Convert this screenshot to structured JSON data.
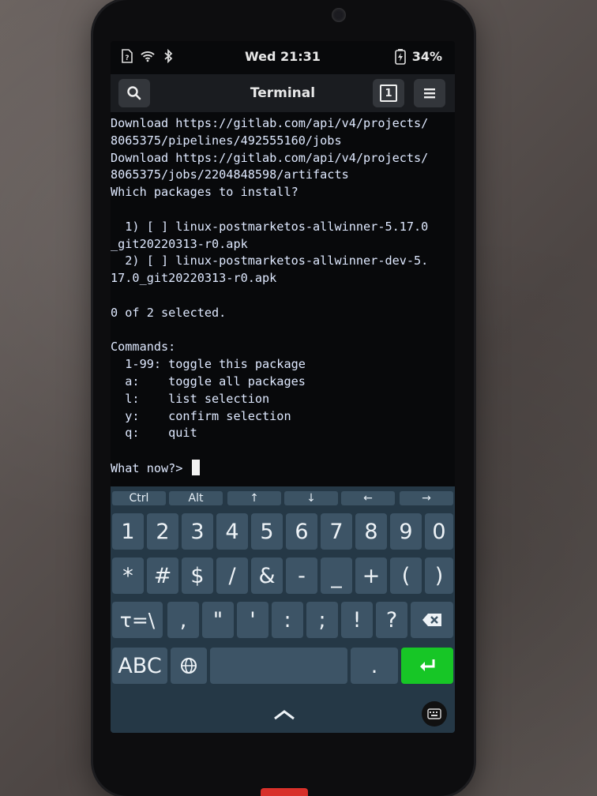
{
  "status": {
    "clock": "Wed 21:31",
    "battery": "34%",
    "icons": [
      "sim-icon",
      "wifi-icon",
      "bluetooth-icon",
      "battery-icon"
    ]
  },
  "header": {
    "title": "Terminal",
    "search_icon": "search-icon",
    "tab_count": "1",
    "menu_icon": "hamburger-menu-icon"
  },
  "terminal": {
    "lines": [
      "Download https://gitlab.com/api/v4/projects/",
      "8065375/pipelines/492555160/jobs",
      "Download https://gitlab.com/api/v4/projects/",
      "8065375/jobs/2204848598/artifacts",
      "Which packages to install?",
      "",
      "  1) [ ] linux-postmarketos-allwinner-5.17.0",
      "_git20220313-r0.apk",
      "  2) [ ] linux-postmarketos-allwinner-dev-5.",
      "17.0_git20220313-r0.apk",
      "",
      "0 of 2 selected.",
      "",
      "Commands:",
      "  1-99: toggle this package",
      "  a:    toggle all packages",
      "  l:    list selection",
      "  y:    confirm selection",
      "  q:    quit",
      ""
    ],
    "prompt": "What now?> "
  },
  "keyboard": {
    "modifiers": [
      "Ctrl",
      "Alt",
      "↑",
      "↓",
      "←",
      "→"
    ],
    "row1": [
      "1",
      "2",
      "3",
      "4",
      "5",
      "6",
      "7",
      "8",
      "9",
      "0"
    ],
    "row2": [
      "*",
      "#",
      "$",
      "/",
      "&",
      "-",
      "_",
      "+",
      "(",
      ")"
    ],
    "row3": [
      "τ=\\",
      ",",
      "\"",
      "'",
      ":",
      ";",
      "!",
      "?"
    ],
    "abc": "ABC",
    "period": ".",
    "colors": {
      "enter": "#17c626",
      "key": "#3d5466",
      "background": "#253846"
    }
  }
}
